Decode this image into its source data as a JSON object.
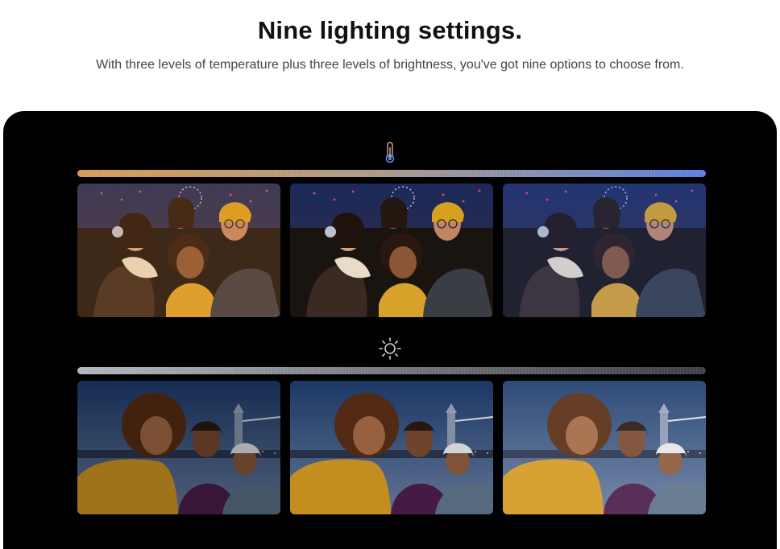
{
  "header": {
    "title": "Nine lighting settings.",
    "subtitle": "With three levels of temperature plus three levels of brightness, you've got nine options to choose from."
  },
  "temperature": {
    "icon": "thermometer-icon",
    "bar_colors": [
      "#d89a52",
      "#5c7ee0"
    ],
    "photos": [
      {
        "tone": "warm"
      },
      {
        "tone": "neutral"
      },
      {
        "tone": "cool"
      }
    ]
  },
  "brightness": {
    "icon": "sun-icon",
    "bar_colors": [
      "#b3b6be",
      "#3d3f44"
    ],
    "photos": [
      {
        "level": "low"
      },
      {
        "level": "medium"
      },
      {
        "level": "high"
      }
    ]
  }
}
